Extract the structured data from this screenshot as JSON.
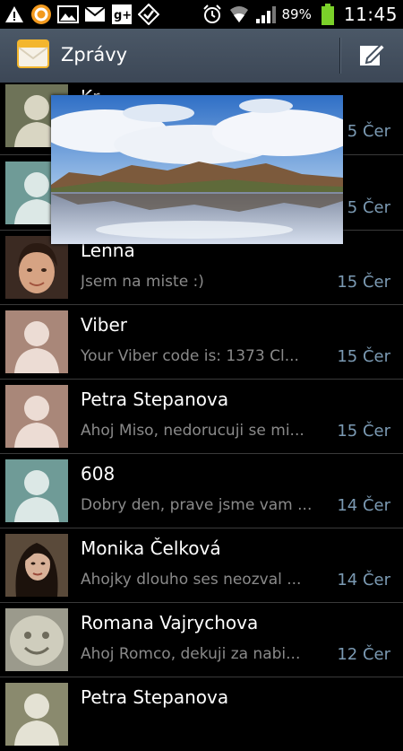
{
  "status_bar": {
    "icons_left": [
      "warning-icon",
      "orange-app-icon",
      "gallery-icon",
      "gmail-icon",
      "google-plus-icon",
      "checkmark-app-icon"
    ],
    "icons_right": [
      "alarm-icon",
      "wifi-icon",
      "signal-icon",
      "battery-icon"
    ],
    "battery": "89%",
    "time": "11:45"
  },
  "header": {
    "title": "Zprávy",
    "compose_icon": "compose-icon"
  },
  "conversations": [
    {
      "name": "Kr...",
      "preview": "",
      "date": "5 Čer",
      "avatar": "default-olive"
    },
    {
      "name": "",
      "preview": "",
      "date": "5 Čer",
      "avatar": "default-teal"
    },
    {
      "name": "Lenna",
      "preview": "Jsem na miste :)",
      "date": "15 Čer",
      "avatar": "photo-woman"
    },
    {
      "name": "Viber",
      "preview": "Your Viber code is: 1373 Cl...",
      "date": "15 Čer",
      "avatar": "default-pink"
    },
    {
      "name": "Petra Stepanova",
      "preview": "Ahoj Miso, nedorucuji se mi...",
      "date": "15 Čer",
      "avatar": "default-pink"
    },
    {
      "name": "608",
      "preview": "Dobry den, prave jsme vam ...",
      "date": "14 Čer",
      "avatar": "default-teal"
    },
    {
      "name": "Monika Čelková",
      "preview": "Ahojky dlouho ses neozval ...",
      "date": "14 Čer",
      "avatar": "photo-dark-hair"
    },
    {
      "name": "Romana Vajrychova",
      "preview": "Ahoj Romco, dekuji za nabi...",
      "date": "12 Čer",
      "avatar": "photo-stone"
    },
    {
      "name": "Petra Stepanova",
      "preview": "",
      "date": "",
      "avatar": "default-olive"
    }
  ],
  "colors": {
    "action_bar": "#455160",
    "date_text": "#7b9ab3",
    "preview_text": "#8a8a8a",
    "battery_green": "#7bd12a"
  }
}
